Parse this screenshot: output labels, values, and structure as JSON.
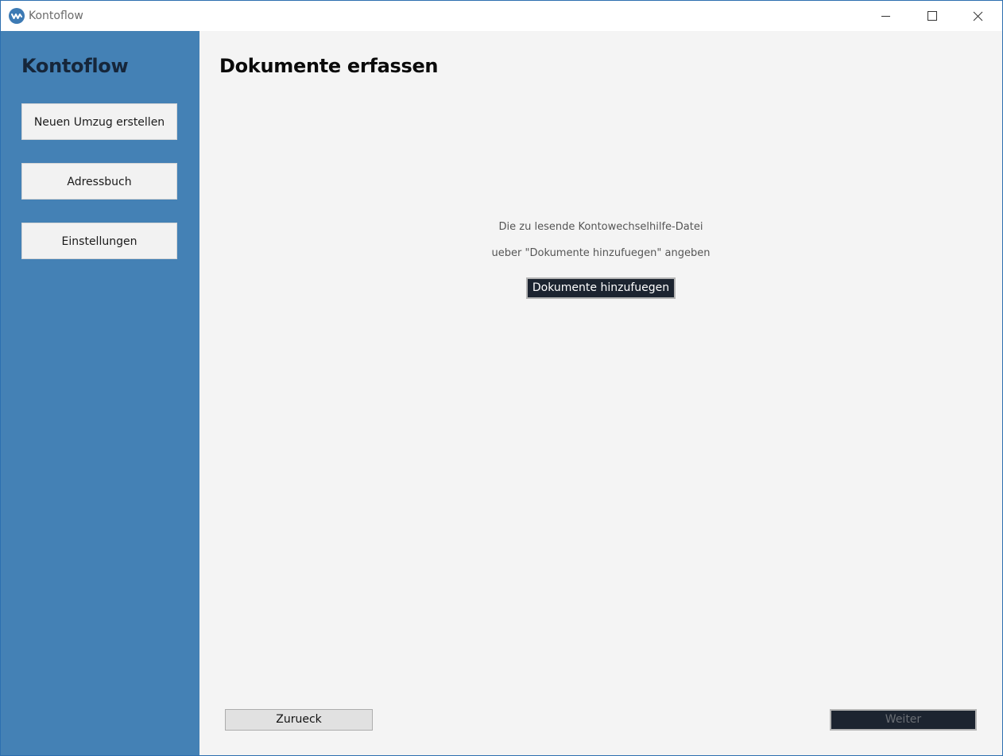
{
  "window": {
    "title": "Kontoflow",
    "app_icon": "kontoflow-logo-icon",
    "controls": {
      "minimize_icon": "minimize-icon",
      "maximize_icon": "maximize-icon",
      "close_icon": "close-icon"
    }
  },
  "sidebar": {
    "title": "Kontoflow",
    "background": "#4481b5",
    "items": [
      {
        "label": "Neuen Umzug erstellen"
      },
      {
        "label": "Adressbuch"
      },
      {
        "label": "Einstellungen"
      }
    ]
  },
  "main": {
    "title": "Dokumente erfassen",
    "info_line_1": "Die zu lesende Kontowechselhilfe-Datei",
    "info_line_2": "ueber \"Dokumente hinzufuegen\" angeben",
    "add_button_label": "Dokumente hinzufuegen",
    "back_button_label": "Zurueck",
    "next_button_label": "Weiter",
    "next_button_enabled": false
  },
  "colors": {
    "accent": "#4481b5",
    "dark_button": "#1c2430"
  }
}
